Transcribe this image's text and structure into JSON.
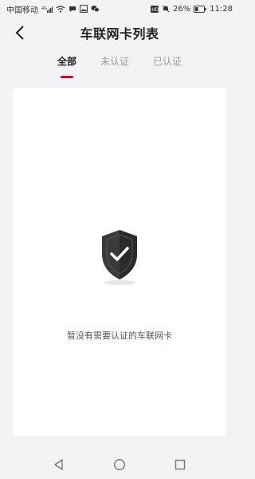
{
  "status_bar": {
    "carrier": "中国移动",
    "battery_percent": "26%",
    "time": "11:28",
    "signal": "4G"
  },
  "header": {
    "title": "车联网卡列表"
  },
  "tabs": [
    {
      "label": "全部",
      "active": true
    },
    {
      "label": "未认证",
      "active": false
    },
    {
      "label": "已认证",
      "active": false
    }
  ],
  "empty_state": {
    "message": "暂没有需要认证的车联网卡",
    "icon": "shield-check-icon"
  },
  "colors": {
    "accent": "#c8102e",
    "background": "#f3f3f5",
    "card": "#ffffff"
  }
}
